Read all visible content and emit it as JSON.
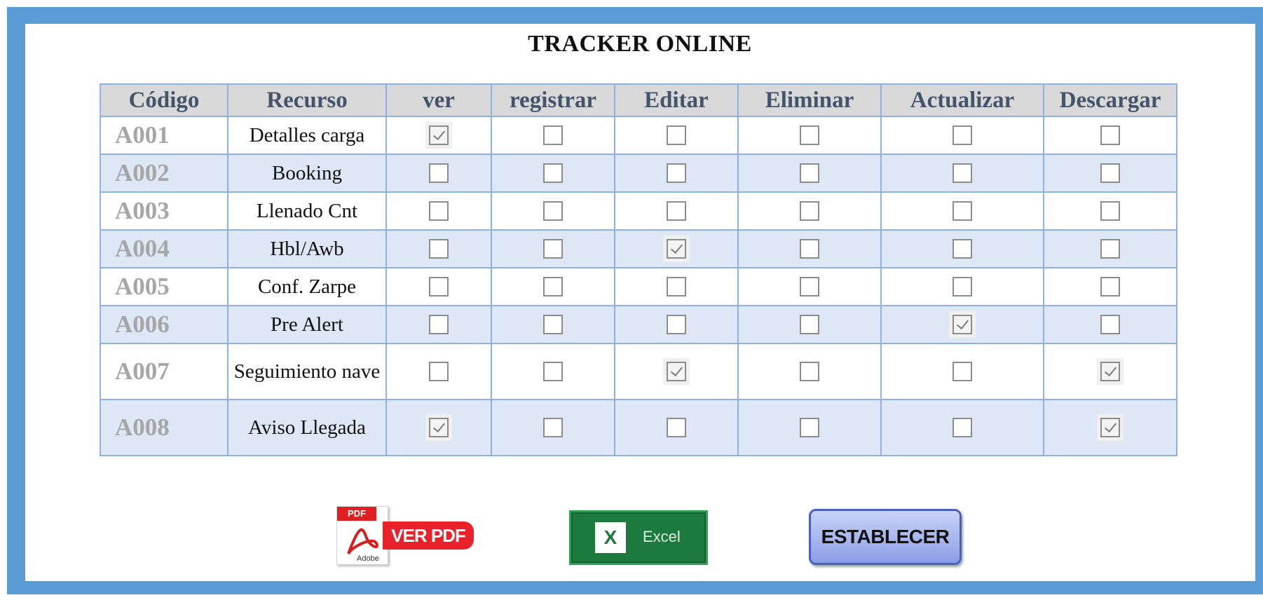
{
  "title": "TRACKER ONLINE",
  "table": {
    "headers": [
      "Código",
      "Recurso",
      "ver",
      "registrar",
      "Editar",
      "Eliminar",
      "Actualizar",
      "Descargar"
    ],
    "rows": [
      {
        "code": "A001",
        "resource": "Detalles carga",
        "checks": [
          true,
          false,
          false,
          false,
          false,
          false
        ]
      },
      {
        "code": "A002",
        "resource": "Booking",
        "checks": [
          false,
          false,
          false,
          false,
          false,
          false
        ]
      },
      {
        "code": "A003",
        "resource": "Llenado Cnt",
        "checks": [
          false,
          false,
          false,
          false,
          false,
          false
        ]
      },
      {
        "code": "A004",
        "resource": "Hbl/Awb",
        "checks": [
          false,
          false,
          true,
          false,
          false,
          false
        ]
      },
      {
        "code": "A005",
        "resource": "Conf. Zarpe",
        "checks": [
          false,
          false,
          false,
          false,
          false,
          false
        ]
      },
      {
        "code": "A006",
        "resource": "Pre Alert",
        "checks": [
          false,
          false,
          false,
          false,
          true,
          false
        ]
      },
      {
        "code": "A007",
        "resource": "Seguimiento nave",
        "checks": [
          false,
          false,
          true,
          false,
          false,
          true
        ]
      },
      {
        "code": "A008",
        "resource": "Aviso Llegada",
        "checks": [
          true,
          false,
          false,
          false,
          false,
          true
        ]
      }
    ]
  },
  "buttons": {
    "pdf_tag": "PDF",
    "pdf_brand": "Adobe",
    "pdf_label": "VER PDF",
    "excel_icon": "X",
    "excel_label": "Excel",
    "establecer_label": "ESTABLECER"
  },
  "colors": {
    "frame": "#5b9bd5",
    "header_bg": "#d9d9d9",
    "header_text": "#44546a",
    "alt_row": "#dde7f6",
    "code_text": "#a6a6a6"
  }
}
